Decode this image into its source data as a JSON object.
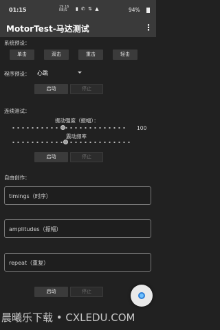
{
  "status": {
    "time": "01:15",
    "net_speed_value": "19.16",
    "net_speed_unit": "KB/S",
    "icons": "▮ ✆ ⇅ ▲",
    "battery": "94%"
  },
  "appbar": {
    "title": "MotorTest-马达测试",
    "more_icon": "⋮"
  },
  "system_preset": {
    "label": "系统预设：",
    "buttons": [
      "单击",
      "双击",
      "重击",
      "轻击"
    ]
  },
  "program_preset": {
    "label": "程序预设：",
    "selected": "心跳",
    "start": "启动",
    "stop": "停止"
  },
  "continuous": {
    "label": "连续测试：",
    "amplitude_label": "振动强度（振幅）：",
    "amplitude_value": "100",
    "amplitude_level": 0.45,
    "frequency_label": "震动频率",
    "frequency_level": 0.45,
    "start": "启动",
    "stop": "停止"
  },
  "freeform": {
    "label": "自由创作：",
    "timings_placeholder": "timings（时序）",
    "amplitudes_placeholder": "amplitudes（振幅）",
    "repeat_placeholder": "repeat（重复）",
    "start": "启动",
    "stop": "停止"
  },
  "watermark": "晨曦乐下载 • CXLEDU.COM"
}
